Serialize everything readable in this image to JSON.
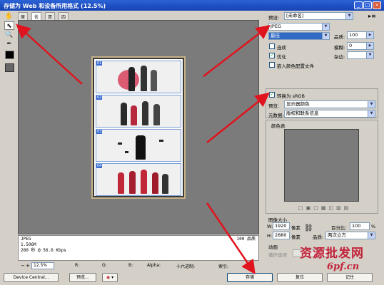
{
  "window": {
    "title": "存储为 Web 和设备所用格式 (12.5%)",
    "controls": {
      "minimize": "_",
      "maximize": "□",
      "close": "×"
    }
  },
  "tools": [
    "hand-icon",
    "slice-select-icon",
    "zoom-icon",
    "eyedropper-icon"
  ],
  "tabs": [
    "原稿",
    "优化",
    "双联",
    "四联"
  ],
  "selected_tab": "优化",
  "info": {
    "format": "JPEG",
    "size": "1.506M",
    "time": "280 秒 @ 56.6 Kbps",
    "quality": "100 品质"
  },
  "status": {
    "zoom": "12.5%",
    "r": "R:",
    "g": "G:",
    "b": "B:",
    "alpha": "Alpha:",
    "hex": "十六进制:",
    "index": "索引:"
  },
  "buttons": {
    "device_central": "Device Central...",
    "preview": "预览...",
    "save": "存储",
    "reset": "复位",
    "done": "记住"
  },
  "settings": {
    "preset_label": "预设:",
    "preset_value": "[未命名]",
    "format_value": "JPEG",
    "quality_preset": "最佳",
    "quality_label": "品质:",
    "quality_value": "100",
    "progressive": "连续",
    "blur_label": "模糊:",
    "blur_value": "0",
    "optimized": "优化",
    "matte_label": "杂边:",
    "embed_profile": "嵌入颜色配置文件",
    "convert_srgb": "转换为 sRGB",
    "preview_label": "预览:",
    "preview_value": "显示器颜色",
    "metadata_label": "元数据:",
    "metadata_value": "版权和联系信息",
    "color_table_label": "颜色表",
    "image_size_label": "图像大小",
    "w_label": "W:",
    "w_value": "1920",
    "h_label": "H:",
    "h_value": "2880",
    "px_unit": "像素",
    "percent_label": "百分比:",
    "percent_value": "100",
    "percent_unit": "%",
    "resample_label": "品质:",
    "resample_value": "两次立方",
    "animation_label": "动画",
    "loop_label": "循环选项"
  },
  "slices": [
    "01",
    "02",
    "03",
    "04"
  ],
  "watermark": {
    "line1": "资源批发网",
    "line2": "6pf.cn"
  },
  "colors": {
    "titlebar": "#1d4fc2",
    "canvas": "#7b7b7b",
    "arrow": "#e0141e",
    "selection": "#316ac5",
    "watermark": "#c2243a"
  }
}
